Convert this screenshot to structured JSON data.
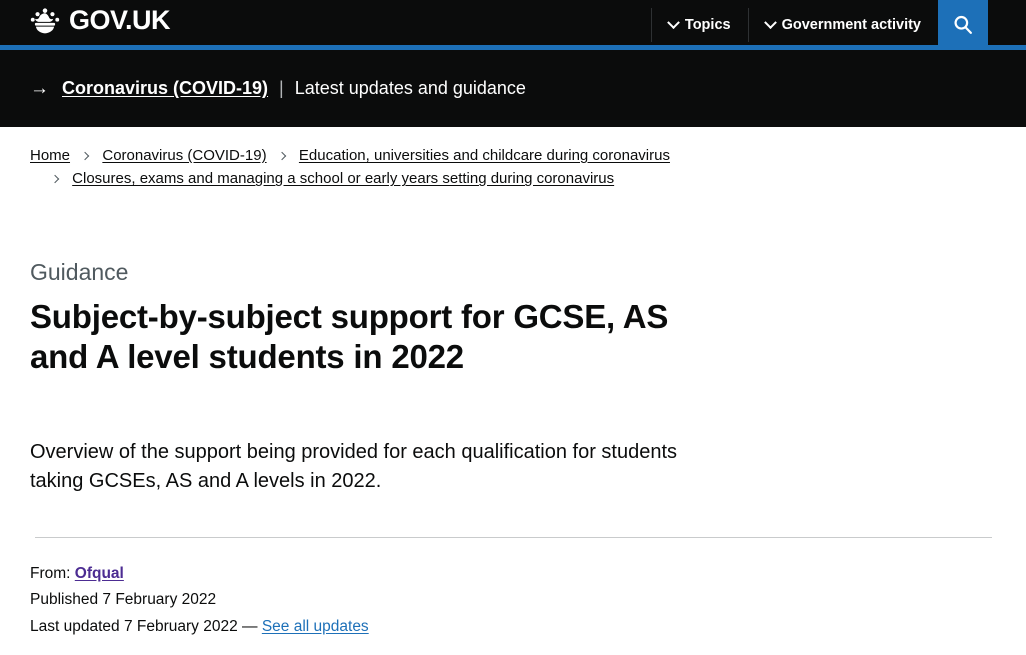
{
  "header": {
    "logo_text": "GOV.UK",
    "logo_icon": "crown-icon",
    "nav": [
      {
        "label": "Topics",
        "icon": "chevron-down-icon"
      },
      {
        "label": "Government activity",
        "icon": "chevron-down-icon"
      }
    ],
    "search_icon": "search-icon",
    "accent_color": "#1d70b8",
    "background_color": "#0b0c0c"
  },
  "covid_banner": {
    "arrow_icon": "arrow-right-icon",
    "link_label": "Coronavirus (COVID-19)",
    "separator": "|",
    "text": "Latest updates and guidance"
  },
  "breadcrumbs": {
    "separator_icon": "chevron-right-icon",
    "line1": [
      "Home",
      "Coronavirus (COVID-19)",
      "Education, universities and childcare during coronavirus"
    ],
    "line2": [
      "Closures, exams and managing a school or early years setting during coronavirus"
    ]
  },
  "main": {
    "guidance_label": "Guidance",
    "title": "Subject-by-subject support for GCSE, AS and A level students in 2022",
    "summary": "Overview of the support being provided for each qualification for students taking GCSEs, AS and A levels in 2022."
  },
  "metadata": {
    "from_label": "From:",
    "from_organisation": "Ofqual",
    "published_label": "Published",
    "published_date": "7 February 2022",
    "last_updated_label": "Last updated",
    "last_updated_date": "7 February 2022",
    "dash": "—",
    "see_all_updates": "See all updates"
  },
  "colors": {
    "link_blue": "#1d70b8",
    "link_visited_purple": "#4c2c92",
    "text_black": "#0b0c0c",
    "text_grey": "#505a5f",
    "rule_grey": "#c9cbcc"
  }
}
